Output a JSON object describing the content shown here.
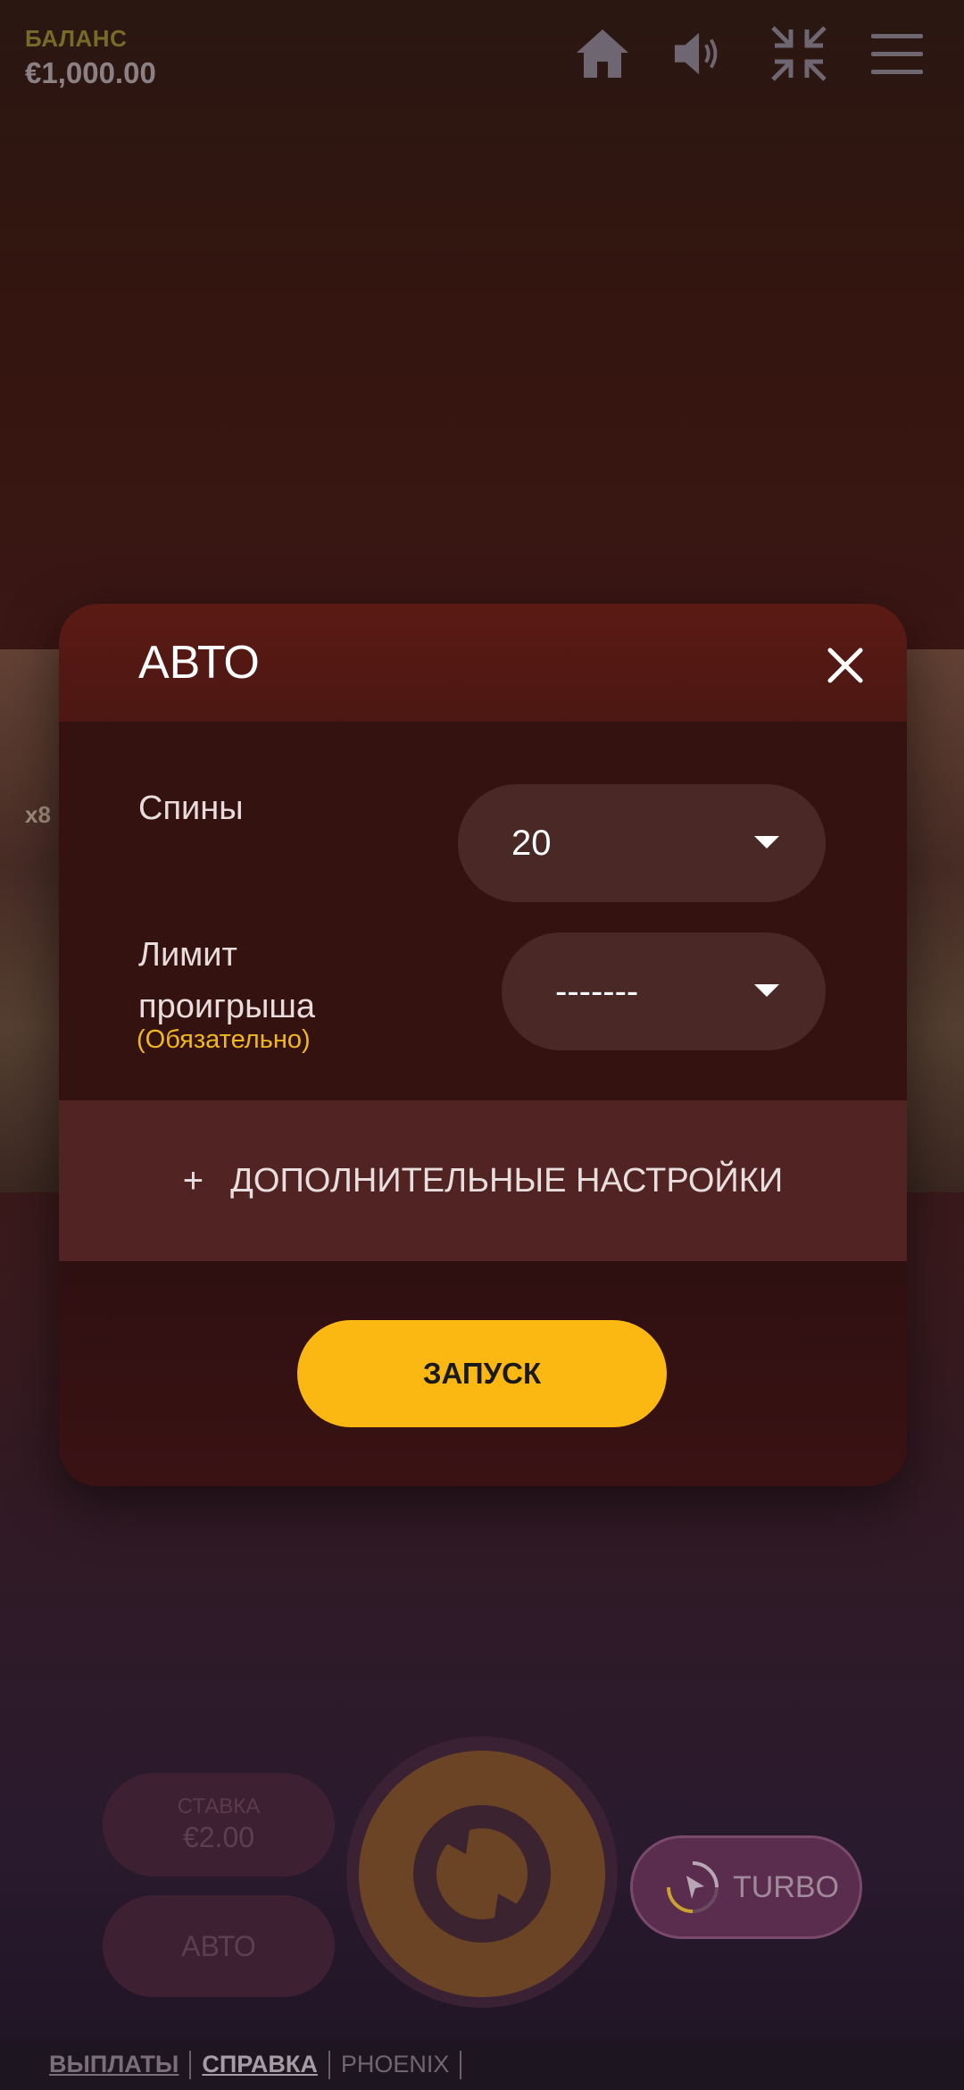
{
  "balance": {
    "label": "БАЛАНС",
    "value": "€1,000.00"
  },
  "top_icons": [
    "home-icon",
    "sound-icon",
    "exit-fullscreen-icon",
    "menu-icon"
  ],
  "background_scene": {
    "multiplier_text": "x8"
  },
  "modal": {
    "title": "АВТО",
    "spins": {
      "label": "Спины",
      "value": "20"
    },
    "loss_limit": {
      "label": "Лимит проигрыша",
      "required": "(Обязательно)",
      "value": "-------"
    },
    "advanced_settings": {
      "plus": "+",
      "label": "ДОПОЛНИТЕЛЬНЫЕ НАСТРОЙКИ"
    },
    "launch_label": "ЗАПУСК"
  },
  "controls": {
    "bet_label": "СТАВКА",
    "bet_value": "€2.00",
    "auto_label": "АВТО",
    "turbo_label": "TURBO"
  },
  "footer": {
    "links": [
      "ВЫПЛАТЫ",
      "СПРАВКА"
    ],
    "brand": "PHOENIX"
  },
  "colors": {
    "accent": "#fbb813",
    "required": "#f0b81e"
  }
}
